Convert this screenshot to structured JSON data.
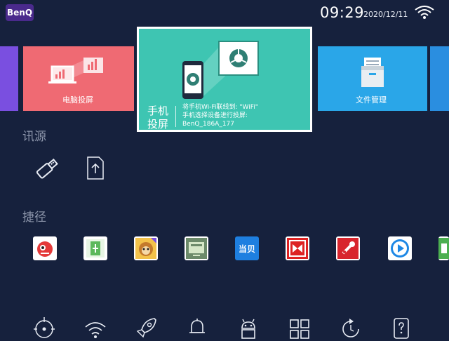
{
  "header": {
    "logo": "BenQ",
    "time": "09:29",
    "date": "2020/12/11",
    "wifi_icon": "wifi-icon"
  },
  "tiles": {
    "pc_projection": {
      "label": "电脑投屏",
      "color": "#ef6a73"
    },
    "phone_projection": {
      "title": "手机投屏",
      "line1": "将手机Wi-Fi联线到: \"WiFi\"",
      "line2": "手机选择设备进行投屏:",
      "line3": "BenQ_186A_177",
      "color": "#3ec5b2"
    },
    "file_manager": {
      "label": "文件管理",
      "color": "#2aa6e8"
    }
  },
  "sources": {
    "title": "讯源",
    "items": [
      {
        "icon": "usb-icon"
      },
      {
        "icon": "upload-file-icon"
      }
    ]
  },
  "shortcuts": {
    "title": "捷径",
    "items": [
      {
        "icon": "red-monster-app-icon"
      },
      {
        "icon": "green-card-app-icon"
      },
      {
        "icon": "monkey-king-app-icon"
      },
      {
        "icon": "tv-screen-app-icon"
      },
      {
        "icon": "dangbei-app-icon",
        "text": "当贝"
      },
      {
        "icon": "red-bow-app-icon"
      },
      {
        "icon": "red-tool-app-icon"
      },
      {
        "icon": "blue-play-app-icon"
      },
      {
        "icon": "green-android-app-icon"
      }
    ]
  },
  "bottom_bar": [
    {
      "icon": "target-icon"
    },
    {
      "icon": "wifi-icon"
    },
    {
      "icon": "rocket-icon"
    },
    {
      "icon": "bell-icon"
    },
    {
      "icon": "android-icon"
    },
    {
      "icon": "apps-grid-icon"
    },
    {
      "icon": "refresh-icon"
    },
    {
      "icon": "help-icon"
    }
  ]
}
